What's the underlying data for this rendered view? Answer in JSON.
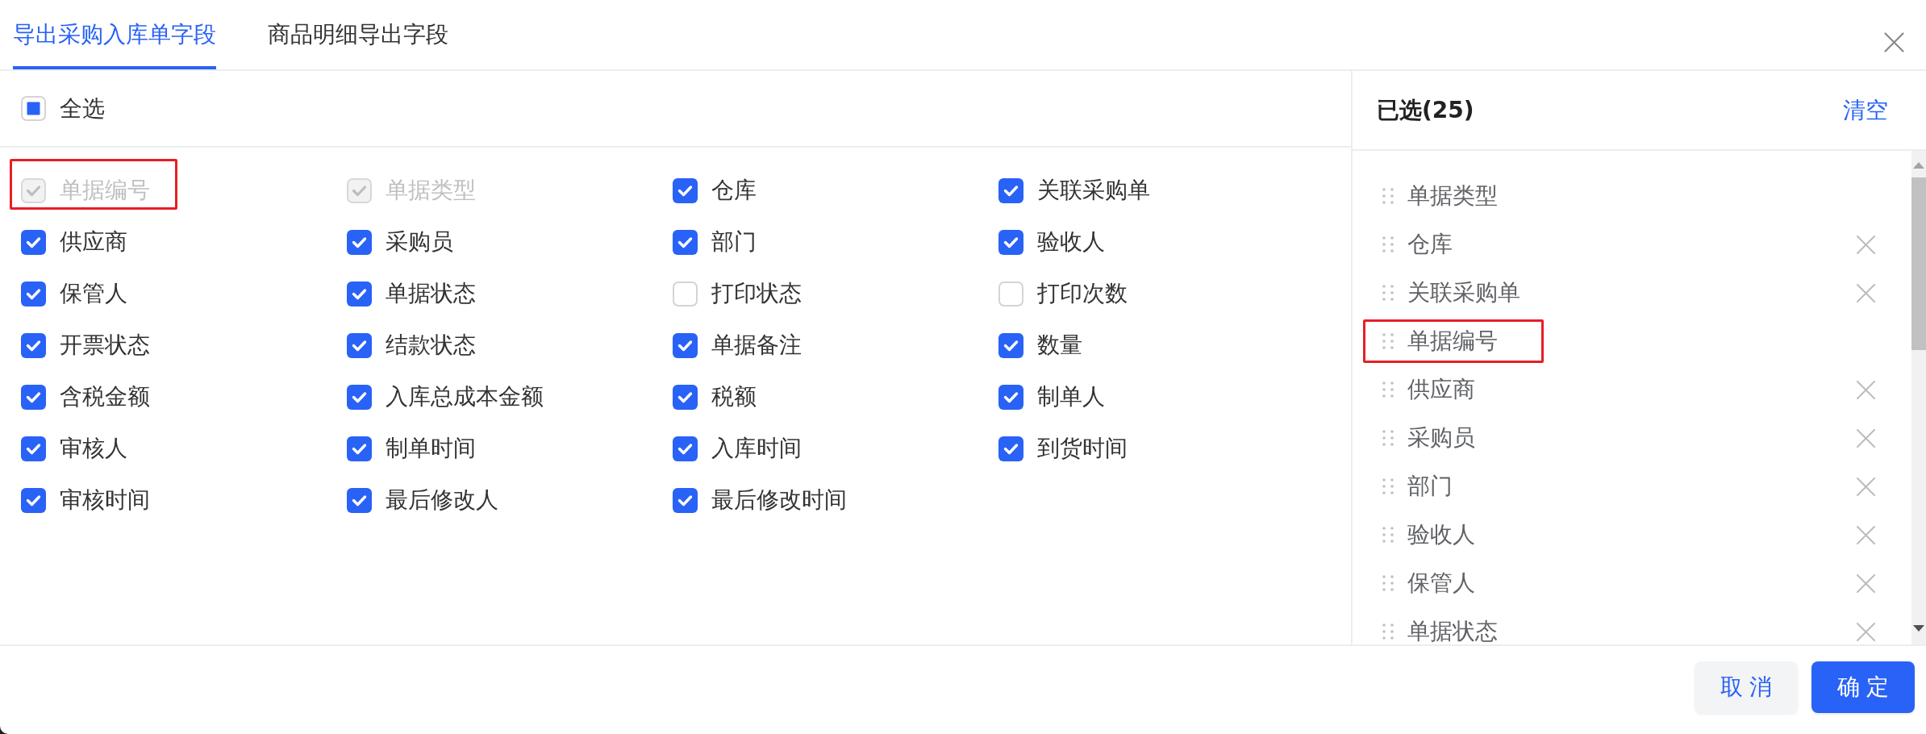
{
  "tabs": [
    {
      "label": "导出采购入库单字段",
      "selected": true
    },
    {
      "label": "商品明细导出字段",
      "selected": false
    }
  ],
  "select_all": {
    "label": "全选",
    "indeterminate": true
  },
  "fields": [
    {
      "label": "单据编号",
      "checked": true,
      "disabled": true,
      "highlighted": true
    },
    {
      "label": "单据类型",
      "checked": true,
      "disabled": true,
      "highlighted": false
    },
    {
      "label": "仓库",
      "checked": true,
      "disabled": false,
      "highlighted": false
    },
    {
      "label": "关联采购单",
      "checked": true,
      "disabled": false,
      "highlighted": false
    },
    {
      "label": "供应商",
      "checked": true,
      "disabled": false,
      "highlighted": false
    },
    {
      "label": "采购员",
      "checked": true,
      "disabled": false,
      "highlighted": false
    },
    {
      "label": "部门",
      "checked": true,
      "disabled": false,
      "highlighted": false
    },
    {
      "label": "验收人",
      "checked": true,
      "disabled": false,
      "highlighted": false
    },
    {
      "label": "保管人",
      "checked": true,
      "disabled": false,
      "highlighted": false
    },
    {
      "label": "单据状态",
      "checked": true,
      "disabled": false,
      "highlighted": false
    },
    {
      "label": "打印状态",
      "checked": false,
      "disabled": false,
      "highlighted": false
    },
    {
      "label": "打印次数",
      "checked": false,
      "disabled": false,
      "highlighted": false
    },
    {
      "label": "开票状态",
      "checked": true,
      "disabled": false,
      "highlighted": false
    },
    {
      "label": "结款状态",
      "checked": true,
      "disabled": false,
      "highlighted": false
    },
    {
      "label": "单据备注",
      "checked": true,
      "disabled": false,
      "highlighted": false
    },
    {
      "label": "数量",
      "checked": true,
      "disabled": false,
      "highlighted": false
    },
    {
      "label": "含税金额",
      "checked": true,
      "disabled": false,
      "highlighted": false
    },
    {
      "label": "入库总成本金额",
      "checked": true,
      "disabled": false,
      "highlighted": false
    },
    {
      "label": "税额",
      "checked": true,
      "disabled": false,
      "highlighted": false
    },
    {
      "label": "制单人",
      "checked": true,
      "disabled": false,
      "highlighted": false
    },
    {
      "label": "审核人",
      "checked": true,
      "disabled": false,
      "highlighted": false
    },
    {
      "label": "制单时间",
      "checked": true,
      "disabled": false,
      "highlighted": false
    },
    {
      "label": "入库时间",
      "checked": true,
      "disabled": false,
      "highlighted": false
    },
    {
      "label": "到货时间",
      "checked": true,
      "disabled": false,
      "highlighted": false
    },
    {
      "label": "审核时间",
      "checked": true,
      "disabled": false,
      "highlighted": false
    },
    {
      "label": "最后修改人",
      "checked": true,
      "disabled": false,
      "highlighted": false
    },
    {
      "label": "最后修改时间",
      "checked": true,
      "disabled": false,
      "highlighted": false
    }
  ],
  "selected_panel": {
    "title": "已选(25)",
    "clear_link": "清空",
    "items": [
      {
        "label": "单据类型",
        "removable": false,
        "highlighted": false
      },
      {
        "label": "仓库",
        "removable": true,
        "highlighted": false
      },
      {
        "label": "关联采购单",
        "removable": true,
        "highlighted": false
      },
      {
        "label": "单据编号",
        "removable": false,
        "highlighted": true
      },
      {
        "label": "供应商",
        "removable": true,
        "highlighted": false
      },
      {
        "label": "采购员",
        "removable": true,
        "highlighted": false
      },
      {
        "label": "部门",
        "removable": true,
        "highlighted": false
      },
      {
        "label": "验收人",
        "removable": true,
        "highlighted": false
      },
      {
        "label": "保管人",
        "removable": true,
        "highlighted": false
      },
      {
        "label": "单据状态",
        "removable": true,
        "highlighted": false
      }
    ]
  },
  "buttons": [
    {
      "label": "取消",
      "kind": "secondary"
    },
    {
      "label": "确定",
      "kind": "primary"
    }
  ]
}
